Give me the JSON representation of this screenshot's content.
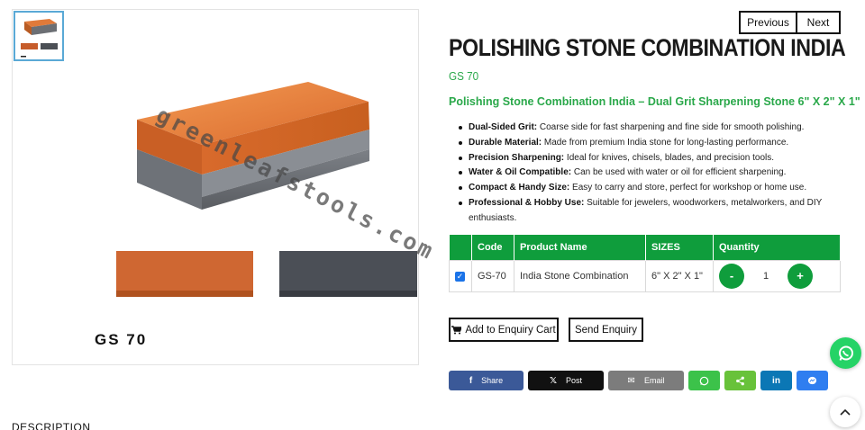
{
  "gallery": {
    "image_code": "GS 70",
    "watermark": "greenleafstools.com"
  },
  "nav": {
    "previous": "Previous",
    "next": "Next"
  },
  "product": {
    "title": "POLISHING STONE COMBINATION INDIA",
    "sku": "GS 70",
    "subtitle": "Polishing Stone Combination India – Dual Grit Sharpening Stone 6\" X 2\" X 1\"",
    "features": [
      {
        "label": "Dual-Sided Grit:",
        "text": " Coarse side for fast sharpening and fine side for smooth polishing."
      },
      {
        "label": "Durable Material:",
        "text": " Made from premium India stone for long-lasting performance."
      },
      {
        "label": "Precision Sharpening:",
        "text": " Ideal for knives, chisels, blades, and precision tools."
      },
      {
        "label": "Water & Oil Compatible:",
        "text": " Can be used with water or oil for efficient sharpening."
      },
      {
        "label": "Compact & Handy Size:",
        "text": " Easy to carry and store, perfect for workshop or home use."
      },
      {
        "label": "Professional & Hobby Use:",
        "text": " Suitable for jewelers, woodworkers, metalworkers, and DIY enthusiasts."
      }
    ]
  },
  "table": {
    "headers": {
      "code": "Code",
      "name": "Product Name",
      "sizes": "SIZES",
      "quantity": "Quantity"
    },
    "row": {
      "checked": true,
      "code": "GS-70",
      "name": "India Stone Combination",
      "size": "6\" X 2\" X 1\"",
      "minus": "-",
      "quantity": "1",
      "plus": "+"
    }
  },
  "actions": {
    "add_cart": "Add to Enquiry Cart",
    "send": "Send Enquiry"
  },
  "share": {
    "facebook": "Share",
    "x": "Post",
    "email": "Email"
  },
  "footer": {
    "description_tab": "DESCRIPTION"
  },
  "colors": {
    "brand_green": "#0f9d3c",
    "accent_green": "#2aa84a",
    "facebook": "#3b5998",
    "whatsapp": "#25d366"
  }
}
